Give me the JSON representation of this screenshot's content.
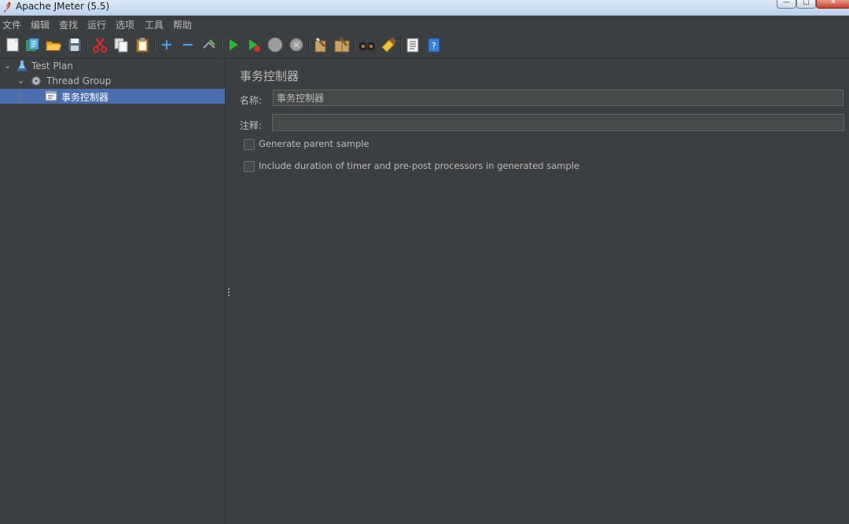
{
  "window": {
    "title": "Apache JMeter (5.5)",
    "controls": {
      "minimize": "—",
      "maximize": "□",
      "close": "✕"
    }
  },
  "menu": [
    "文件",
    "编辑",
    "查找",
    "运行",
    "选项",
    "工具",
    "帮助"
  ],
  "toolbar": [
    {
      "icon": "new-icon"
    },
    {
      "icon": "templates-icon"
    },
    {
      "icon": "open-icon"
    },
    {
      "icon": "save-icon"
    },
    {
      "icon": "cut-icon"
    },
    {
      "icon": "copy-icon"
    },
    {
      "icon": "paste-icon"
    },
    {
      "icon": "expand-icon"
    },
    {
      "icon": "collapse-icon"
    },
    {
      "icon": "toggle-icon"
    },
    {
      "icon": "start-icon"
    },
    {
      "icon": "start-no-pauses-icon"
    },
    {
      "icon": "stop-icon"
    },
    {
      "icon": "shutdown-icon"
    },
    {
      "icon": "clear-icon"
    },
    {
      "icon": "clear-all-icon"
    },
    {
      "icon": "search-icon"
    },
    {
      "icon": "reset-search-icon"
    },
    {
      "icon": "function-helper-icon"
    },
    {
      "icon": "help-icon"
    }
  ],
  "tree": [
    {
      "label": "Test Plan",
      "icon": "test-plan-icon",
      "expanded": true,
      "selected": false
    },
    {
      "label": "Thread Group",
      "icon": "thread-group-icon",
      "expanded": true,
      "selected": false
    },
    {
      "label": "事务控制器",
      "icon": "transaction-controller-icon",
      "selected": true
    }
  ],
  "panel": {
    "title": "事务控制器",
    "name_label": "名称:",
    "name_value": "事务控制器",
    "comment_label": "注释:",
    "comment_value": "",
    "checkboxes": [
      {
        "label": "Generate parent sample",
        "checked": false
      },
      {
        "label": "Include duration of timer and pre-post processors in generated sample",
        "checked": false
      }
    ]
  },
  "colors": {
    "background": "#3c3f41",
    "selection": "#4b6eaf",
    "text": "#bbbbbb",
    "field_bg": "#45494a"
  }
}
